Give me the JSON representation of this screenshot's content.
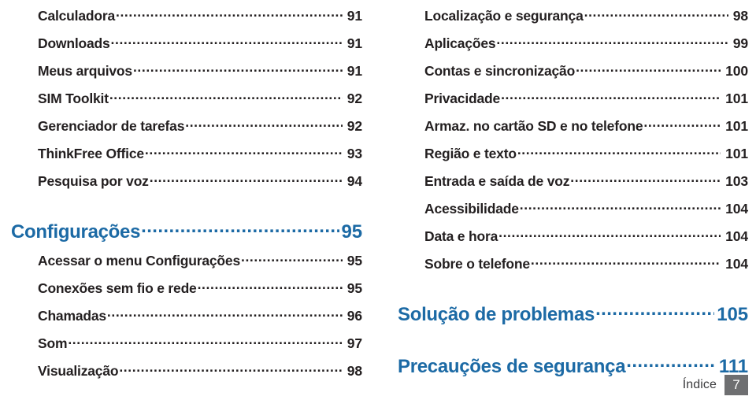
{
  "document": {
    "type": "table-of-contents",
    "language": "pt-BR",
    "footer": {
      "label": "Índice",
      "page_number": "7"
    },
    "colors": {
      "heading_blue": "#1c6aa5",
      "body_text": "#231f20",
      "page_box_gray": "#6e6f71",
      "background": "#ffffff"
    }
  },
  "columns": {
    "left": {
      "entries": [
        {
          "label": "Calculadora",
          "page": "91",
          "level": "sub"
        },
        {
          "label": "Downloads",
          "page": "91",
          "level": "sub"
        },
        {
          "label": "Meus arquivos",
          "page": "91",
          "level": "sub"
        },
        {
          "label": "SIM Toolkit",
          "page": "92",
          "level": "sub"
        },
        {
          "label": "Gerenciador de tarefas",
          "page": "92",
          "level": "sub"
        },
        {
          "label": "ThinkFree Office",
          "page": "93",
          "level": "sub"
        },
        {
          "label": "Pesquisa por voz",
          "page": "94",
          "level": "sub"
        },
        {
          "label": "Configurações",
          "page": "95",
          "level": "heading"
        },
        {
          "label": "Acessar o menu Configurações",
          "page": "95",
          "level": "sub"
        },
        {
          "label": "Conexões sem fio e rede",
          "page": "95",
          "level": "sub"
        },
        {
          "label": "Chamadas",
          "page": "96",
          "level": "sub"
        },
        {
          "label": "Som",
          "page": "97",
          "level": "sub"
        },
        {
          "label": "Visualização",
          "page": "98",
          "level": "sub"
        }
      ]
    },
    "right": {
      "entries": [
        {
          "label": "Localização e segurança",
          "page": "98",
          "level": "sub"
        },
        {
          "label": "Aplicações",
          "page": "99",
          "level": "sub"
        },
        {
          "label": "Contas e sincronização",
          "page": "100",
          "level": "sub"
        },
        {
          "label": "Privacidade",
          "page": "101",
          "level": "sub"
        },
        {
          "label": "Armaz. no cartão SD e no telefone",
          "page": "101",
          "level": "sub"
        },
        {
          "label": "Região e texto",
          "page": "101",
          "level": "sub"
        },
        {
          "label": "Entrada e saída de voz",
          "page": "103",
          "level": "sub"
        },
        {
          "label": "Acessibilidade",
          "page": "104",
          "level": "sub"
        },
        {
          "label": "Data e hora",
          "page": "104",
          "level": "sub"
        },
        {
          "label": "Sobre o telefone",
          "page": "104",
          "level": "sub"
        },
        {
          "label": "Solução de problemas",
          "page": "105",
          "level": "heading"
        },
        {
          "label": "Precauções de segurança",
          "page": "111",
          "level": "heading"
        }
      ]
    }
  }
}
